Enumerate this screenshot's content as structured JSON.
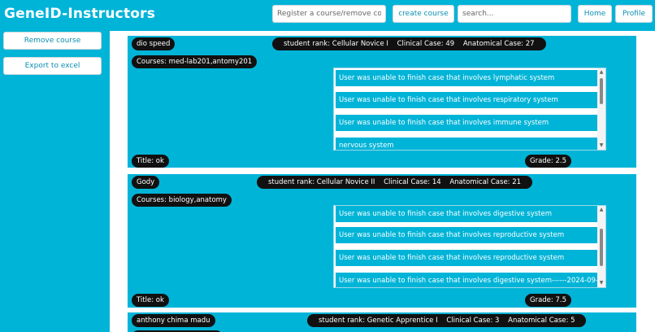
{
  "app": {
    "title": "GeneID-Instructors"
  },
  "header": {
    "register_placeholder": "Register a course/remove course",
    "create_course_label": "create course",
    "search_placeholder": "search...",
    "home_label": "Home",
    "profile_label": "Profile"
  },
  "sidebar": {
    "remove_course_label": "Remove course",
    "export_excel_label": "Export to excel"
  },
  "students": [
    {
      "name": "dio speed",
      "rank": "student rank: Cellular Novice I",
      "clinical": "Clinical Case: 49",
      "anatomical": "Anatomical Case: 27",
      "courses": "Courses: med-lab201,antomy201",
      "issues": [
        "User was unable to finish case that involves lymphatic system",
        "User was unable to finish case that involves respiratory system",
        "User was unable to finish case that involves immune system",
        "nervous system"
      ],
      "title": "Title: ok",
      "grade": "Grade: 2.5"
    },
    {
      "name": "Gody",
      "rank": "student rank: Cellular Novice II",
      "clinical": "Clinical Case: 14",
      "anatomical": "Anatomical Case: 21",
      "courses": "Courses: biology,anatomy",
      "issues": [
        "User was unable to finish case that involves digestive system",
        "User was unable to finish case that involves reproductive system",
        "User was unable to finish case that involves reproductive system",
        "User was unable to finish case that involves digestive system------2024-09-"
      ],
      "title": "Title: ok",
      "grade": "Grade: 7.5"
    },
    {
      "name": "anthony chima madu",
      "rank": "student rank: Genetic Apprentice I",
      "clinical": "Clinical Case: 3",
      "anatomical": "Anatomical Case: 5"
    }
  ],
  "colors": {
    "background": "#00b4d8",
    "pill": "#111111",
    "panel": "#ffffff",
    "button_text": "#0a8fb0"
  },
  "icons": {
    "scroll_up": "scroll-up-arrow-icon",
    "scroll_down": "scroll-down-arrow-icon"
  }
}
